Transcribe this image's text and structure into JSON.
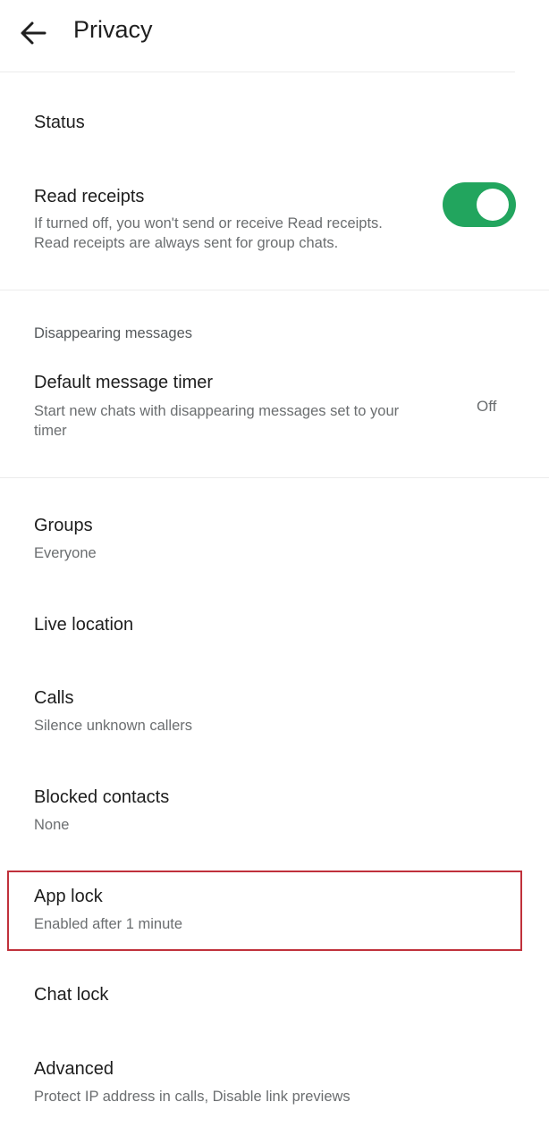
{
  "header": {
    "title": "Privacy",
    "back_icon": "arrow-left-icon"
  },
  "items": {
    "status": {
      "title": "Status"
    },
    "read_receipts": {
      "title": "Read receipts",
      "subtitle_line1": "If turned off, you won't send or receive Read receipts.",
      "subtitle_line2": "Read receipts are always sent for group chats.",
      "toggle_on": true,
      "toggle_color": "#22a55e"
    },
    "disappearing": {
      "section_label": "Disappearing messages",
      "title": "Default message timer",
      "subtitle_line1": "Start new chats with disappearing messages set to your",
      "subtitle_line2": "timer",
      "value": "Off"
    },
    "groups": {
      "title": "Groups",
      "subtitle": "Everyone"
    },
    "live_location": {
      "title": "Live location"
    },
    "calls": {
      "title": "Calls",
      "subtitle": "Silence unknown callers"
    },
    "blocked": {
      "title": "Blocked contacts",
      "subtitle": "None"
    },
    "app_lock": {
      "title": "App lock",
      "subtitle": "Enabled after 1 minute",
      "highlight_color": "#c0313b"
    },
    "chat_lock": {
      "title": "Chat lock"
    },
    "advanced": {
      "title": "Advanced",
      "subtitle": "Protect IP address in calls, Disable link previews"
    }
  }
}
